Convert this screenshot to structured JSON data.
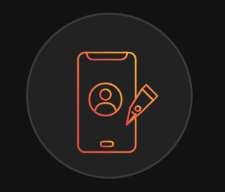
{
  "icon": {
    "name": "mobile-profile-edit-icon",
    "parts": [
      "smartphone-icon",
      "user-avatar-icon",
      "fountain-pen-nib-icon"
    ],
    "gradient": {
      "start": "#e9464a",
      "middle": "#f0713e",
      "end": "#f7b23a"
    }
  },
  "colors": {
    "background": "#121212",
    "badge_fill": "#222222",
    "badge_ring": "#3a3a3a"
  }
}
